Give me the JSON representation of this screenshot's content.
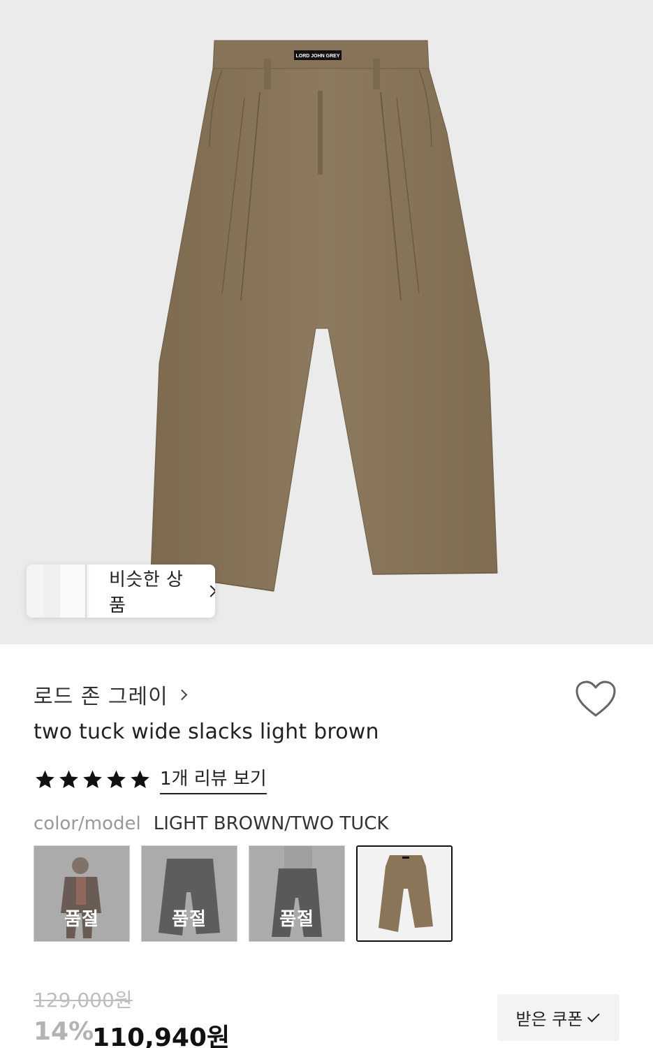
{
  "hero": {
    "image": "light-brown-wide-slacks-product-photo",
    "waistband_label": "LORD JOHN GREY",
    "similar_button_label": "비슷한 상품"
  },
  "product": {
    "brand": "로드 존 그레이",
    "title": "two tuck wide slacks light brown",
    "rating": 5,
    "review_link": "1개 리뷰 보기",
    "option_label": "color/model",
    "option_value": "LIGHT BROWN/TWO TUCK",
    "variants": [
      {
        "image": "brown-suit-model-thumbnail",
        "status": "품절"
      },
      {
        "image": "charcoal-slacks-thumbnail",
        "status": "품절"
      },
      {
        "image": "charcoal-slacks-model-thumbnail",
        "status": "품절"
      },
      {
        "image": "light-brown-slacks-thumbnail",
        "status": ""
      }
    ]
  },
  "pricing": {
    "original_price": "129,000원",
    "discount": "14%",
    "final_price": "110,940원",
    "coupon_label": "받은 쿠폰"
  },
  "colors": {
    "pants": "#8a7558",
    "hero_bg": "#ebebeb",
    "text_primary": "#111111",
    "text_muted": "#999999"
  }
}
